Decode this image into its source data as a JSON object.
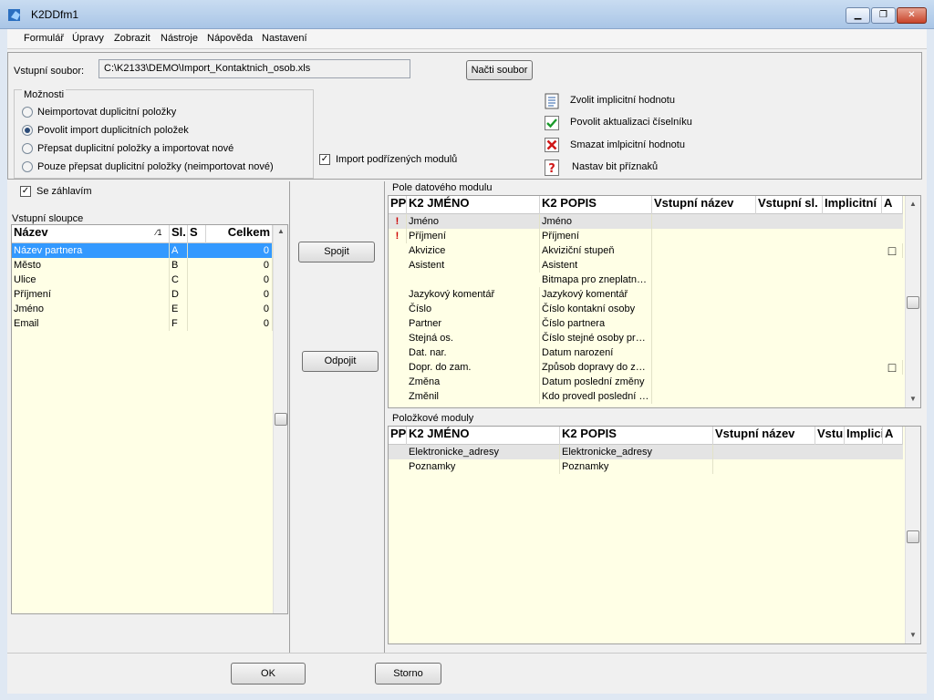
{
  "window": {
    "title": "K2DDfm1",
    "min": "▁",
    "max": "❐",
    "close": "✕"
  },
  "menu": [
    "Formulář",
    "Úpravy",
    "Zobrazit",
    "Nástroje",
    "Nápověda",
    "Nastavení"
  ],
  "source": {
    "label": "Vstupní soubor:",
    "path": "C:\\K2133\\DEMO\\Import_Kontaktnich_osob.xls",
    "load_button": "Načti soubor"
  },
  "options": {
    "title": "Možnosti",
    "radios": [
      {
        "label": "Neimportovat duplicitní položky",
        "selected": false
      },
      {
        "label": "Povolit import duplicitních položek",
        "selected": true
      },
      {
        "label": "Přepsat duplicitní položky a importovat nové",
        "selected": false
      },
      {
        "label": "Pouze přepsat duplicitní položky (neimportovat nové)",
        "selected": false
      }
    ],
    "import_sub": {
      "label": "Import podřízených modulů",
      "checked": "✓"
    }
  },
  "actions": [
    {
      "label": "Zvolit implicitní hodnotu",
      "icon": "document-list-icon"
    },
    {
      "label": "Povolit aktualizaci číselníku",
      "icon": "green-check-icon"
    },
    {
      "label": "Smazat imlpicitní hodnotu",
      "icon": "red-x-icon"
    },
    {
      "label": "Nastav bit příznaků",
      "icon": "question-icon"
    }
  ],
  "header_check": {
    "label": "Se záhlavím",
    "checked": "✓"
  },
  "input_columns": {
    "title": "Vstupní sloupce",
    "headers": [
      "Název",
      "Sl.",
      "S",
      "Celkem"
    ],
    "sort_mark": "∕1",
    "rows": [
      [
        "Název partnera",
        "A",
        "",
        "0"
      ],
      [
        "Město",
        "B",
        "",
        "0"
      ],
      [
        "Ulice",
        "C",
        "",
        "0"
      ],
      [
        "Příjmení",
        "D",
        "",
        "0"
      ],
      [
        "Jméno",
        "E",
        "",
        "0"
      ],
      [
        "Email",
        "F",
        "",
        "0"
      ]
    ]
  },
  "buttons": {
    "join": "Spojit",
    "unjoin": "Odpojit",
    "ok": "OK",
    "cancel": "Storno"
  },
  "data_fields": {
    "title": "Pole datového modulu",
    "headers": [
      "PP",
      "K2 JMÉNO",
      "K2 POPIS",
      "Vstupní název",
      "Vstupní sl.",
      "Implicitní",
      "A"
    ],
    "rows": [
      [
        "!",
        "Jméno",
        "Jméno",
        "",
        "",
        "",
        ""
      ],
      [
        "!",
        "Příjmení",
        "Příjmení",
        "",
        "",
        "",
        ""
      ],
      [
        "",
        "Akvizice",
        "Akviziční stupeň",
        "",
        "",
        "",
        "□"
      ],
      [
        "",
        "Asistent",
        "Asistent",
        "",
        "",
        "",
        ""
      ],
      [
        "",
        "",
        "Bitmapa pro zneplatn…",
        "",
        "",
        "",
        ""
      ],
      [
        "",
        "Jazykový komentář",
        "Jazykový komentář",
        "",
        "",
        "",
        ""
      ],
      [
        "",
        "Číslo",
        "Číslo kontakní osoby",
        "",
        "",
        "",
        ""
      ],
      [
        "",
        "Partner",
        "Číslo partnera",
        "",
        "",
        "",
        ""
      ],
      [
        "",
        "Stejná os.",
        "Číslo stejné  osoby pr…",
        "",
        "",
        "",
        ""
      ],
      [
        "",
        "Dat. nar.",
        "Datum narození",
        "",
        "",
        "",
        ""
      ],
      [
        "",
        "Dopr. do zam.",
        "Způsob dopravy do z…",
        "",
        "",
        "",
        "□"
      ],
      [
        "",
        "Změna",
        "Datum poslední změny",
        "",
        "",
        "",
        ""
      ],
      [
        "",
        "Změnil",
        "Kdo provedl poslední …",
        "",
        "",
        "",
        ""
      ]
    ]
  },
  "item_modules": {
    "title": "Položkové moduly",
    "headers": [
      "PP",
      "K2 JMÉNO",
      "K2 POPIS",
      "Vstupní název",
      "Vstu",
      "Implici",
      "A"
    ],
    "rows": [
      [
        "",
        "Elektronicke_adresy",
        "Elektronicke_adresy",
        "",
        "",
        "",
        ""
      ],
      [
        "",
        "Poznamky",
        "Poznamky",
        "",
        "",
        "",
        ""
      ]
    ]
  },
  "colors": {
    "selection": "#3399ff",
    "grid_bg": "#ffffe6",
    "required": "#cc0000"
  }
}
